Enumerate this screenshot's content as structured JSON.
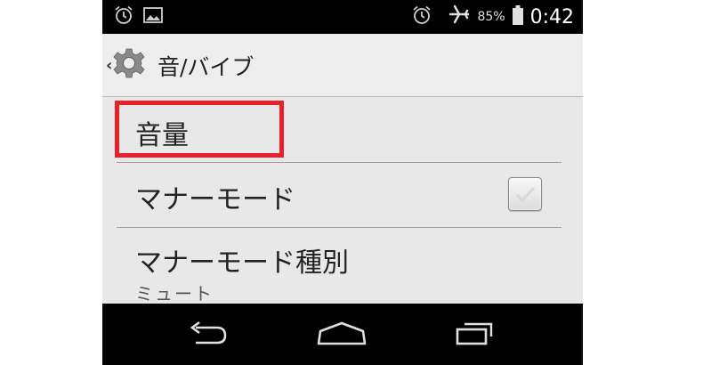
{
  "status_bar": {
    "left_icons": [
      "alarm-icon",
      "image-icon"
    ],
    "right_icons": [
      "alarm-icon",
      "airplane-mode-icon",
      "battery-icon"
    ],
    "battery_percent": "85%",
    "time": "0:42"
  },
  "action_bar": {
    "icon": "gear-icon",
    "title": "音/バイブ"
  },
  "settings": {
    "items": [
      {
        "title": "音量"
      },
      {
        "title": "マナーモード",
        "checked": false
      },
      {
        "title": "マナーモード種別",
        "summary": "ミュート"
      }
    ]
  },
  "highlight_color": "#e8202a",
  "nav_bar": {
    "buttons": [
      "back-icon",
      "home-icon",
      "recent-apps-icon"
    ]
  }
}
